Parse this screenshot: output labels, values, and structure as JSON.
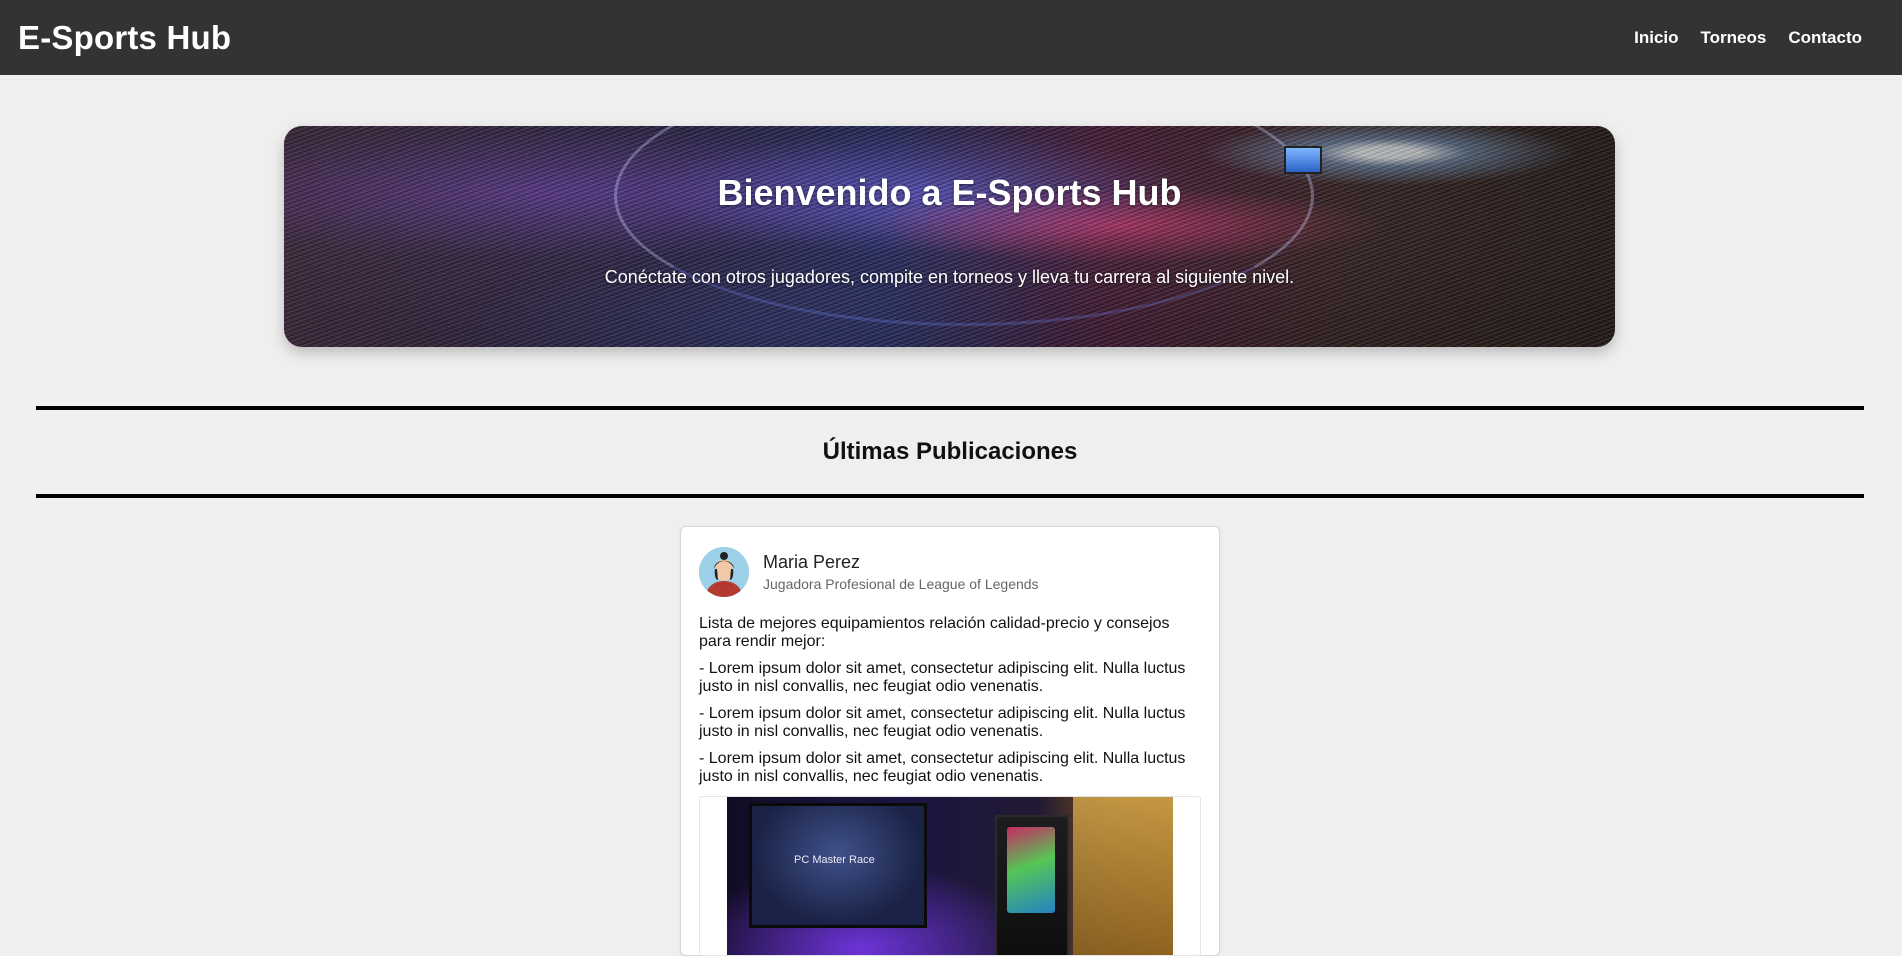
{
  "header": {
    "brand": "E-Sports Hub",
    "nav": [
      "Inicio",
      "Torneos",
      "Contacto"
    ]
  },
  "hero": {
    "title": "Bienvenido a E-Sports Hub",
    "subtitle": "Conéctate con otros jugadores, compite en torneos y lleva tu carrera al siguiente nivel."
  },
  "section": {
    "title": "Últimas Publicaciones"
  },
  "post": {
    "author_name": "Maria Perez",
    "author_role": "Jugadora Profesional de League of Legends",
    "body": [
      "Lista de mejores equipamientos relación calidad-precio y consejos para rendir mejor:",
      "- Lorem ipsum dolor sit amet, consectetur adipiscing elit. Nulla luctus justo in nisl convallis, nec feugiat odio venenatis.",
      "- Lorem ipsum dolor sit amet, consectetur adipiscing elit. Nulla luctus justo in nisl convallis, nec feugiat odio venenatis.",
      "- Lorem ipsum dolor sit amet, consectetur adipiscing elit. Nulla luctus justo in nisl convallis, nec feugiat odio venenatis."
    ],
    "image_monitor_text": "PC Master Race"
  },
  "colors": {
    "header_bg": "#333333",
    "page_bg": "#efefef",
    "card_bg": "#ffffff"
  }
}
